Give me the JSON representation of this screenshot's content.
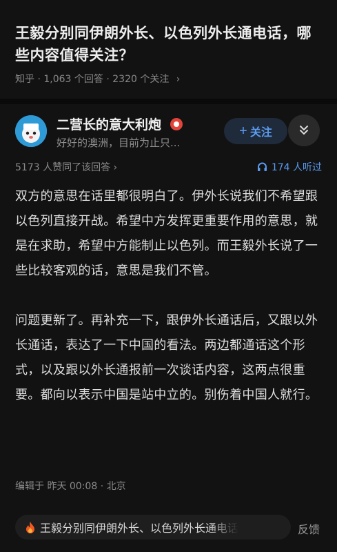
{
  "question": {
    "title": "王毅分别同伊朗外长、以色列外长通电话，哪些内容值得关注？",
    "source": "知乎",
    "answers": "1,063 个回答",
    "followers": "2320 个关注",
    "chevron": "›"
  },
  "author": {
    "name": "二营长的意大利炮",
    "bio": "好好的澳洲，目前为止只...",
    "follow_label": "关注",
    "follow_plus": "+",
    "badge_icon": "medal-icon"
  },
  "stats": {
    "agree": "5173 人赞同了该回答",
    "chevron": "›",
    "listen": "174 人听过"
  },
  "content": {
    "paragraphs": [
      "双方的意思在话里都很明白了。伊外长说我们不希望跟以色列直接开战。希望中方发挥更重要作用的意思，就是在求助，希望中方能制止以色列。而王毅外长说了一些比较客观的话，意思是我们不管。",
      "问题更新了。再补充一下，跟伊外长通话后，又跟以外长通话，表达了一下中国的看法。两边都通话这个形式，以及跟以外长通报前一次谈话内容，这两点很重要。都向以表示中国是站中立的。别伤着中国人就行。"
    ]
  },
  "edit_meta": "编辑于 昨天 00:08 · 北京",
  "bottom": {
    "hot_title": "王毅分别同伊朗外长、以色列外长通电话",
    "feedback": "反馈"
  },
  "colors": {
    "background": "#121212",
    "accent_blue": "#5a9bf0",
    "hot_orange": "#f05a22"
  }
}
